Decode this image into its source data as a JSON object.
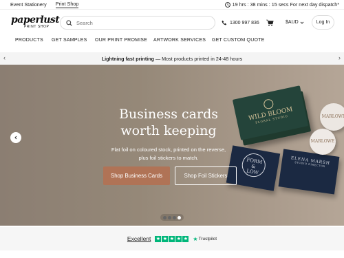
{
  "topbar": {
    "links": [
      "Event Stationery",
      "Print Shop"
    ],
    "countdown": "19 hrs : 38 mins : 15 secs For next day dispatch*"
  },
  "header": {
    "logo_word": "paperlust",
    "logo_sub": "PRINT SHOP",
    "search_placeholder": "Search",
    "phone": "1300 997 836",
    "currency": "$AUD",
    "login": "Log In"
  },
  "nav": {
    "items": [
      "PRODUCTS",
      "GET SAMPLES",
      "OUR PRINT PROMISE",
      "ARTWORK SERVICES",
      "GET CUSTOM QUOTE"
    ]
  },
  "promo": {
    "bold": "Lightning fast printing",
    "rest": " — Most products printed in 24-48 hours"
  },
  "hero": {
    "title_line1": "Business cards",
    "title_line2": "worth keeping",
    "sub_line1": "Flat foil on coloured stock, printed on the reverse,",
    "sub_line2": "plus foil stickers to match.",
    "btn_primary": "Shop Business Cards",
    "btn_secondary": "Shop Foil Stickers",
    "card1_line1": "WILD BLOOM",
    "card1_line2": "FLORAL STUDIO",
    "card2_line1": "FORM",
    "card2_line2": "&",
    "card2_line3": "LOW",
    "card3_line1": "ELENA MARSH",
    "card3_line2": "STUDIO DIRECTOR",
    "sticker1": "MARLOWE",
    "sticker2": "MARLOWE",
    "slides_total": 4,
    "slide_active": 4
  },
  "trust": {
    "rating": "Excellent",
    "brand": "Trustpilot"
  },
  "colors": {
    "primary_btn": "#b07356",
    "trustpilot_green": "#00b67a",
    "card_green": "#1f3a2e",
    "card_navy": "#1b2942"
  }
}
